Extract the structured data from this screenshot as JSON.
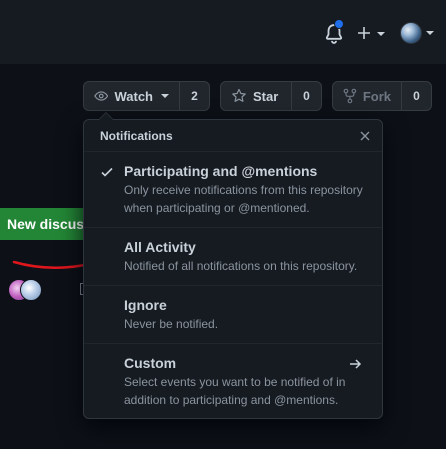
{
  "header": {
    "icons": [
      "bell-icon",
      "plus-icon",
      "avatar"
    ]
  },
  "repo_actions": {
    "watch": {
      "label": "Watch",
      "count": "2",
      "icon": "eye-icon"
    },
    "star": {
      "label": "Star",
      "count": "0",
      "icon": "star-icon"
    },
    "fork": {
      "label": "Fork",
      "count": "0",
      "icon": "fork-icon"
    }
  },
  "background": {
    "new_discussion_label": "New discuss"
  },
  "notifications": {
    "title": "Notifications",
    "items": [
      {
        "title": "Participating and @mentions",
        "description": "Only receive notifications from this repository when participating or @mentioned.",
        "selected": true
      },
      {
        "title": "All Activity",
        "description": "Notified of all notifications on this repository.",
        "selected": false
      },
      {
        "title": "Ignore",
        "description": "Never be notified.",
        "selected": false
      },
      {
        "title": "Custom",
        "description": "Select events you want to be notified of in addition to participating and @mentions.",
        "selected": false,
        "has_arrow": true
      }
    ]
  },
  "colors": {
    "accent_blue": "#1f6feb",
    "success_green": "#238636",
    "annotation_red": "#e0161d"
  }
}
